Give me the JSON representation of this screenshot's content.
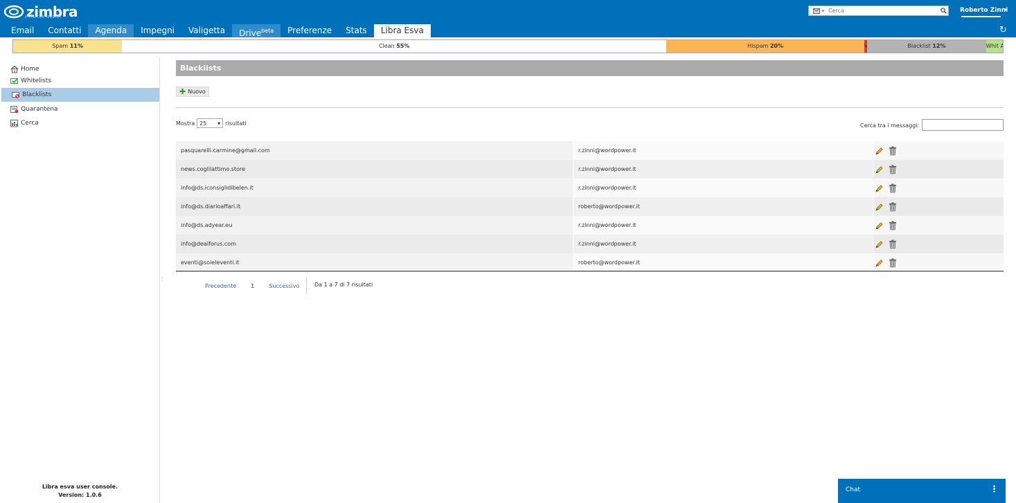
{
  "app": {
    "logo": "zimbra",
    "logo_sub": "A SYNACOR PRODUCT"
  },
  "header": {
    "search_placeholder": "Cerca",
    "user_name": "Roberto Zinni"
  },
  "tabs": [
    {
      "label": "Email"
    },
    {
      "label": "Contatti"
    },
    {
      "label": "Agenda"
    },
    {
      "label": "Impegni"
    },
    {
      "label": "Valigetta"
    },
    {
      "label": "Drive",
      "sup": "beta"
    },
    {
      "label": "Preferenze"
    },
    {
      "label": "Stats"
    },
    {
      "label": "Libra Esva"
    }
  ],
  "ratio_bar": {
    "segments": [
      {
        "label": "Spam",
        "value": "11%",
        "percent": 11,
        "color": "#fbe38e"
      },
      {
        "label": "Clean",
        "value": "55%",
        "percent": 55,
        "color": "#ffffff"
      },
      {
        "label": "Hispam",
        "value": "20%",
        "percent": 20,
        "color": "#fbb552"
      },
      {
        "label": "V",
        "value": "",
        "percent": 0.3,
        "color": "#e0382b"
      },
      {
        "label": "Blacklist",
        "value": "12%",
        "percent": 12,
        "color": "#b3b3b3"
      },
      {
        "label": "Whit A",
        "value": "",
        "percent": 1.7,
        "color": "#b7e08a"
      }
    ]
  },
  "sidebar": {
    "items": [
      {
        "label": "Home",
        "icon": "home-icon"
      },
      {
        "label": "Whitelists",
        "icon": "whitelist-icon"
      },
      {
        "label": "Blacklists",
        "icon": "blacklist-icon"
      },
      {
        "label": "Quarantena",
        "icon": "quarantine-icon"
      },
      {
        "label": "Cerca",
        "icon": "search-report-icon"
      }
    ],
    "footer_line1": "Libra esva user console.",
    "footer_line2": "Version: 1.0.6"
  },
  "main": {
    "title": "Blacklists",
    "new_button": "Nuovo",
    "show_label": "Mostra",
    "show_value": "25",
    "results_label": "risultati",
    "filter_label": "Cerca tra i messaggi:",
    "rows": [
      {
        "from": "pasquarelli.carmine@gmail.com",
        "to": "r.zinni@wordpower.it"
      },
      {
        "from": "news.coglilattimo.store",
        "to": "r.zinni@wordpower.it"
      },
      {
        "from": "info@ds.iconsiglidibelen.it",
        "to": "r.zinni@wordpower.it"
      },
      {
        "from": "info@ds.diarioaffari.it",
        "to": "roberto@wordpower.it"
      },
      {
        "from": "info@ds.adyear.eu",
        "to": "r.zinni@wordpower.it"
      },
      {
        "from": "info@dealforus.com",
        "to": "r.zinni@wordpower.it"
      },
      {
        "from": "eventi@soieleventi.it",
        "to": "roberto@wordpower.it"
      }
    ],
    "pager": {
      "prev": "Precedente",
      "page": "1",
      "next": "Successivo",
      "info": "Da 1 a 7 di 7 risultati"
    }
  },
  "chat": {
    "label": "Chat"
  }
}
